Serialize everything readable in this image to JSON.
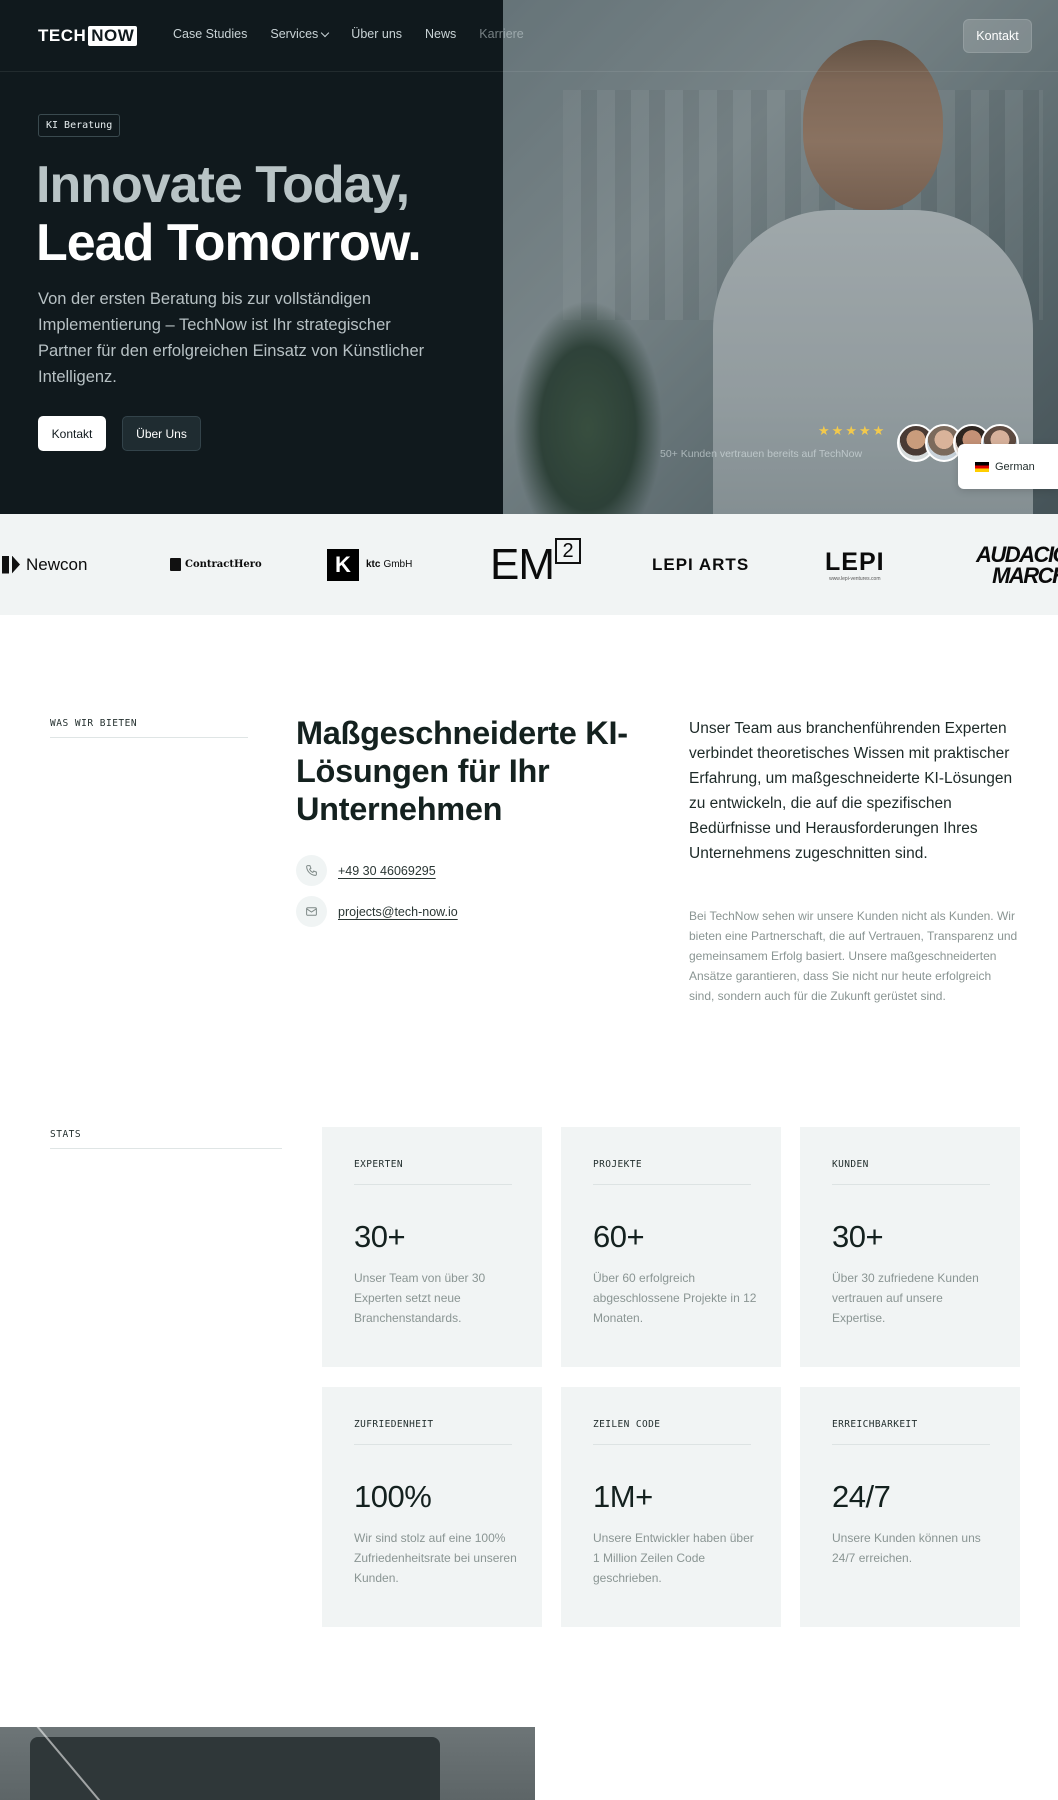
{
  "nav": {
    "logo_left": "TECH",
    "logo_right": "NOW",
    "links": [
      "Case Studies",
      "Services",
      "Über uns",
      "News",
      "Karriere"
    ],
    "cta": "Kontakt"
  },
  "hero": {
    "badge": "KI Beratung",
    "headline_line1": "Innovate Today,",
    "headline_line2": "Lead Tomorrow.",
    "subtitle": "Von der ersten Beratung bis zur vollständigen Implementierung – TechNow ist Ihr strategischer Partner für den erfolgreichen Einsatz von Künstlicher Intelligenz.",
    "primary_button": "Kontakt",
    "secondary_button": "Über Uns",
    "rating_stars": 5,
    "trust_text": "50+ Kunden vertrauen bereits auf TechNow",
    "language": "German"
  },
  "logos": {
    "newcon": "Newcon",
    "contracthero": "ContractHero",
    "ktc_mark": "K",
    "ktc_name_bold": "ktc",
    "ktc_name": "GmbH",
    "em_main": "EM",
    "em_sup": "2",
    "lepi_arts": "LEPI ARTS",
    "lepi": "LEPI",
    "lepi_url": "www.lepi-ventures.com",
    "audacious_line1": "AUDACIOUS",
    "audacious_line2": "MARCHY"
  },
  "offer": {
    "eyebrow": "WAS WIR BIETEN",
    "title": "Maßgeschneiderte KI-Lösungen für Ihr Unternehmen",
    "phone": "+49 30 46069295",
    "email": "projects@tech-now.io",
    "lead": "Unser Team aus branchenführenden Experten verbindet theoretisches Wissen mit praktischer Erfahrung, um maßgeschneiderte KI-Lösungen zu entwickeln, die auf die spezifischen Bedürfnisse und Herausforderungen Ihres Unternehmens zugeschnitten sind.",
    "body": "Bei TechNow sehen wir unsere Kunden nicht als Kunden. Wir bieten eine Partnerschaft, die auf Vertrauen, Transparenz und gemeinsamem Erfolg basiert. Unsere maßgeschneiderten Ansätze garantieren, dass Sie nicht nur heute erfolgreich sind, sondern auch für die Zukunft gerüstet sind."
  },
  "stats": {
    "eyebrow": "STATS",
    "cards": [
      {
        "label": "EXPERTEN",
        "value": "30+",
        "desc": "Unser Team von über 30 Experten setzt neue Branchenstandards."
      },
      {
        "label": "PROJEKTE",
        "value": "60+",
        "desc": "Über 60 erfolgreich abgeschlossene Projekte in 12 Monaten."
      },
      {
        "label": "KUNDEN",
        "value": "30+",
        "desc": "Über 30 zufriedene Kunden vertrauen auf unsere Expertise."
      },
      {
        "label": "ZUFRIEDENHEIT",
        "value": "100%",
        "desc": "Wir sind stolz auf eine 100% Zufriedenheitsrate bei unseren Kunden."
      },
      {
        "label": "ZEILEN CODE",
        "value": "1M+",
        "desc": "Unsere Entwickler haben über 1 Million Zeilen Code geschrieben."
      },
      {
        "label": "ERREICHBARKEIT",
        "value": "24/7",
        "desc": "Unsere Kunden können uns 24/7 erreichen."
      }
    ]
  },
  "colors": {
    "hero_bg": "#10191d",
    "section_bg": "#f1f4f4",
    "star": "#f2c94c"
  }
}
